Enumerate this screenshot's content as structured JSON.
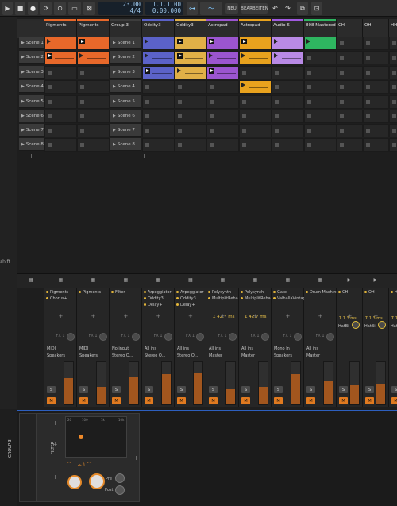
{
  "transport": {
    "play_icon": "play-icon",
    "stop_icon": "stop-icon",
    "record_icon": "record-icon",
    "tempo": "123.00",
    "signature": "4/4",
    "position": "1.1.1.00",
    "time": "0:00.000",
    "new_label": "NEU",
    "edit_label": "BEARBEITEN"
  },
  "left": {
    "shift_label": "shift"
  },
  "columns": [
    {
      "name": "",
      "color": "#2a2a2a"
    },
    {
      "name": "Pigments",
      "color": "#e8682a"
    },
    {
      "name": "Pigments",
      "color": "#e8682a"
    },
    {
      "name": "Group 3",
      "color": "#3d3d3d"
    },
    {
      "name": "Oddity3",
      "color": "#5b62c8"
    },
    {
      "name": "Oddity3",
      "color": "#e0b047"
    },
    {
      "name": "Astropad",
      "color": "#9b55cf"
    },
    {
      "name": "Astropad",
      "color": "#e8a21e"
    },
    {
      "name": "Audio 6",
      "color": "#a05adf"
    },
    {
      "name": "808 Mastered ...",
      "color": "#2eb560"
    },
    {
      "name": "CH",
      "color": "#2b2b2b"
    },
    {
      "name": "OH",
      "color": "#2b2b2b"
    },
    {
      "name": "HH",
      "color": "#2b2b2b"
    }
  ],
  "scenes": [
    "Scene 1",
    "Scene 2",
    "Scene 3",
    "Scene 4",
    "Scene 5",
    "Scene 6",
    "Scene 7",
    "Scene 8"
  ],
  "group_scenes": [
    "Scene 1",
    "Scene 2",
    "Scene 3",
    "Scene 4",
    "Scene 5",
    "Scene 6",
    "Scene 7",
    "Scene 8"
  ],
  "mixer": {
    "devices": [
      [
        "Pigments",
        "Chorus+"
      ],
      [
        "Pigments"
      ],
      [
        "Filter"
      ],
      [
        "Arpeggiator",
        "Oddity3",
        "Delay+"
      ],
      [
        "Arpeggiator",
        "Oddity3",
        "Delay+"
      ],
      [
        "Polysynth",
        "MultiplitReha..."
      ],
      [
        "Polysynth",
        "MultiplitReha..."
      ],
      [
        "Gate",
        "ValhallaVintag..."
      ],
      [
        "Drum Machine"
      ],
      [
        "CH"
      ],
      [
        "OH"
      ],
      [
        "HH"
      ]
    ],
    "latency_1": "Σ 42.7 ms",
    "latency_2": "Σ 42.7 ms",
    "fx_label": "FX 1",
    "inputs": [
      "MIDI",
      "MIDI",
      "No input",
      "All ins",
      "All ins",
      "All ins",
      "All ins",
      "Mono In",
      "All ins"
    ],
    "outputs": [
      "Speakers",
      "Speakers",
      "Stereo O...",
      "Stereo O...",
      "Stereo O...",
      "Master",
      "Master",
      "Speakers",
      "Master"
    ],
    "small_latency": "Σ 1.3 ms",
    "hatbi": "HatBi",
    "solo_label": "S",
    "mute_label": "M"
  },
  "device_panel": {
    "group_label": "GROUP 3",
    "filter_label": "FILTER",
    "xy_ticks": [
      "20",
      "100",
      "1k",
      "10k"
    ],
    "pre_label": "Pre",
    "post_label": "Post"
  }
}
